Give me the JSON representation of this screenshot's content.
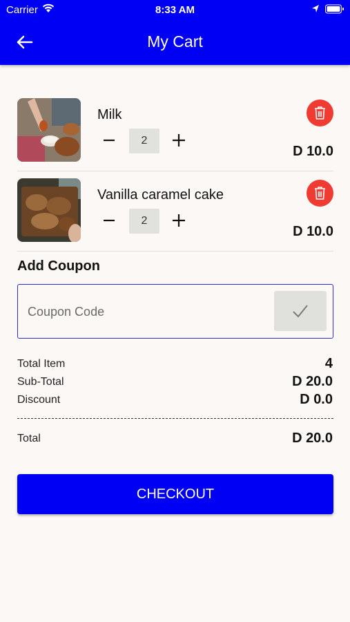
{
  "status_bar": {
    "carrier": "Carrier",
    "time": "8:33 AM"
  },
  "header": {
    "title": "My Cart",
    "back_icon": "arrow-left-icon"
  },
  "cart": {
    "items": [
      {
        "name": "Milk",
        "quantity": "2",
        "price": "D 10.0"
      },
      {
        "name": "Vanilla caramel cake",
        "quantity": "2",
        "price": "D 10.0"
      }
    ]
  },
  "coupon": {
    "title": "Add Coupon",
    "placeholder": "Coupon Code"
  },
  "summary": {
    "total_item_label": "Total Item",
    "total_item_value": "4",
    "subtotal_label": "Sub-Total",
    "subtotal_value": "D 20.0",
    "discount_label": "Discount",
    "discount_value": "D 0.0",
    "total_label": "Total",
    "total_value": "D 20.0"
  },
  "checkout_label": "CHECKOUT",
  "colors": {
    "primary": "#0000f5",
    "delete": "#ef3b32",
    "background": "#fbf8f5"
  }
}
